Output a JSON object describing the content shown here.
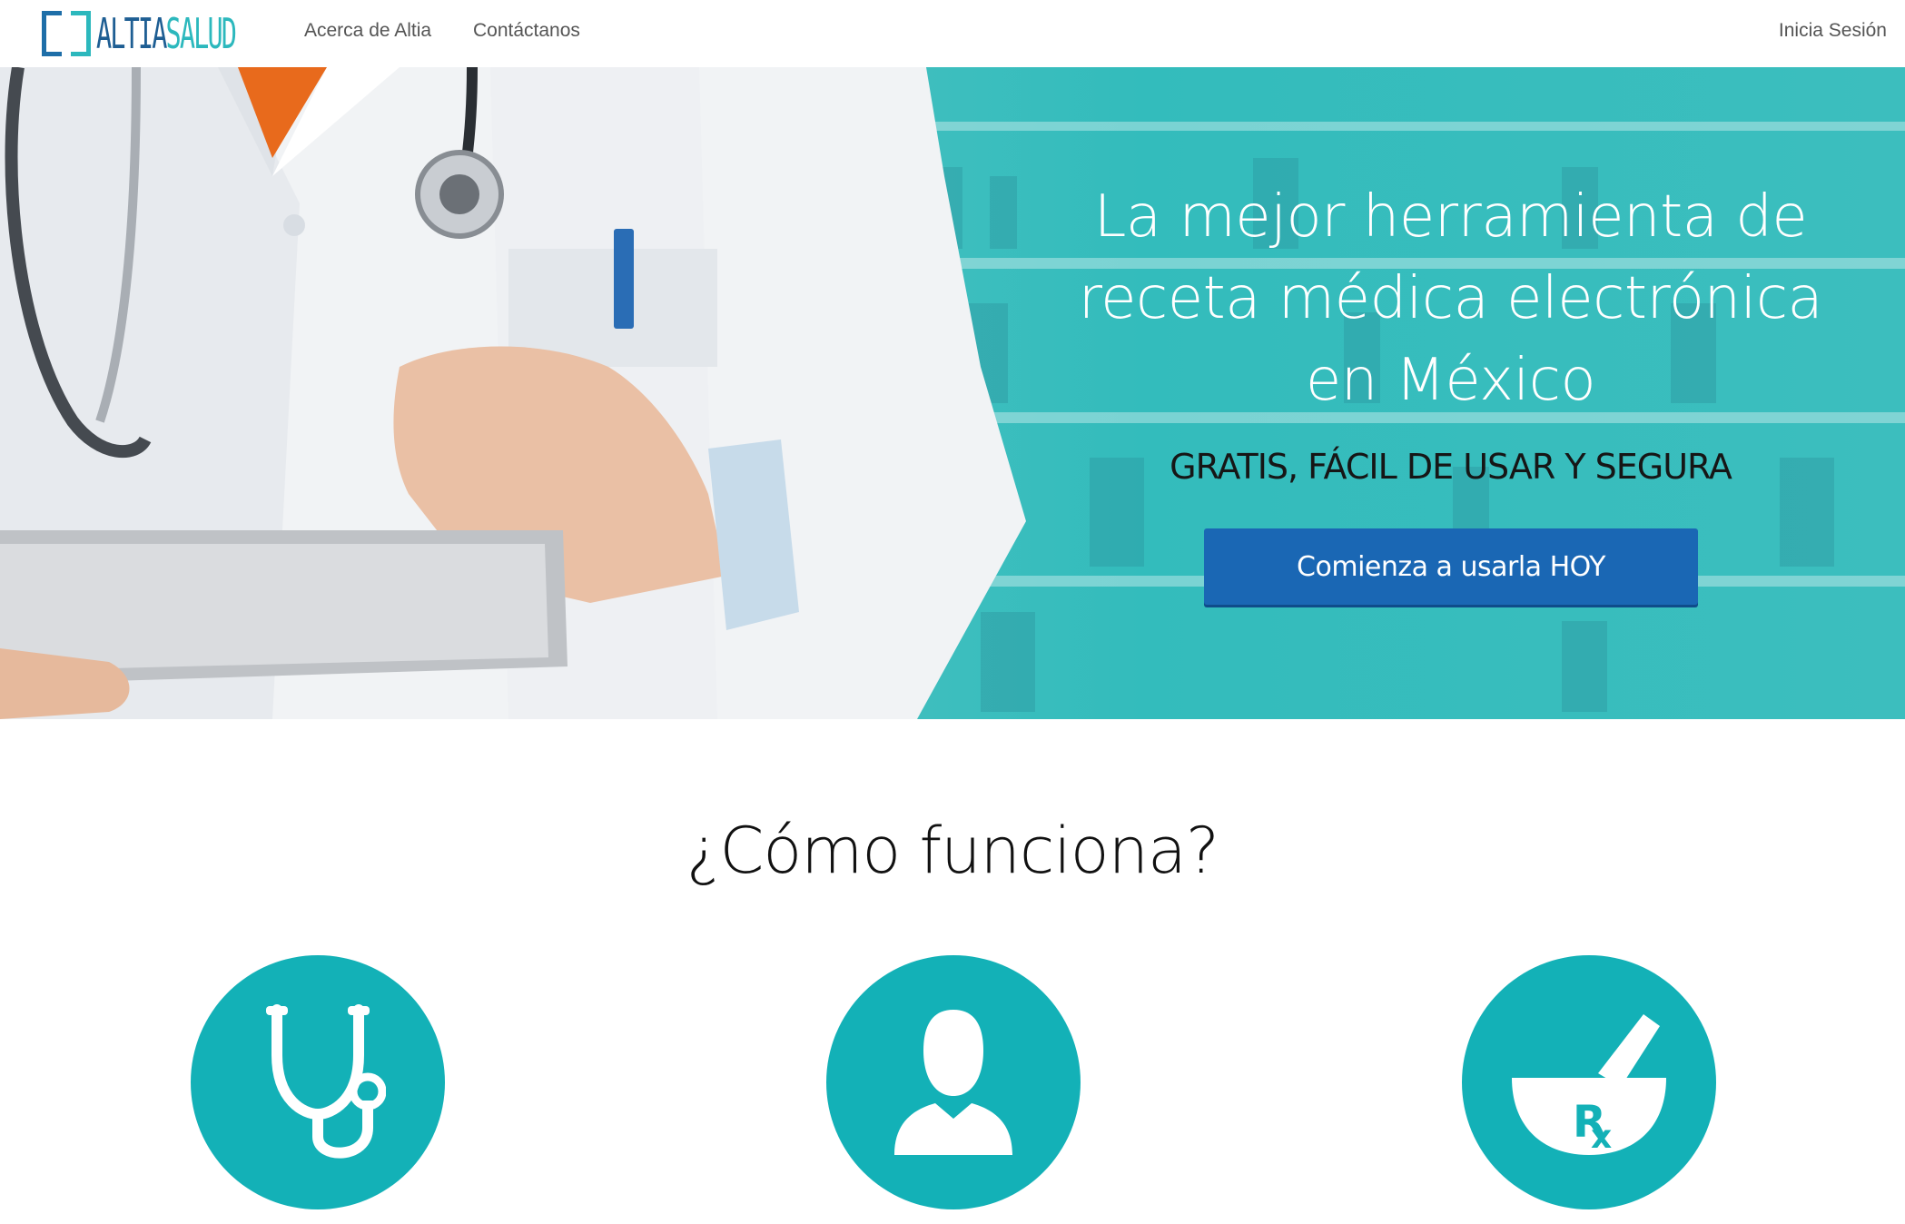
{
  "brand": {
    "logo_part1": "ALTIA",
    "logo_part2": "SALUD",
    "primary_color": "#1e5e93",
    "accent_color": "#2cb8bd"
  },
  "nav": {
    "about": "Acerca de Altia",
    "contact": "Contáctanos",
    "login": "Inicia Sesión"
  },
  "hero": {
    "title_line1": "La mejor herramienta de",
    "title_line2": "receta médica electrónica",
    "title_line3": "en México",
    "subtitle": "GRATIS, FÁCIL DE USAR Y SEGURA",
    "cta": "Comienza a usarla HOY",
    "cta_color": "#1a67b4",
    "background_color": "#3cbebe"
  },
  "how_it_works": {
    "title": "¿Cómo funciona?",
    "circle_color": "#13b1b7",
    "icons": [
      "stethoscope-icon",
      "patient-icon",
      "mortar-pestle-rx-icon"
    ]
  }
}
